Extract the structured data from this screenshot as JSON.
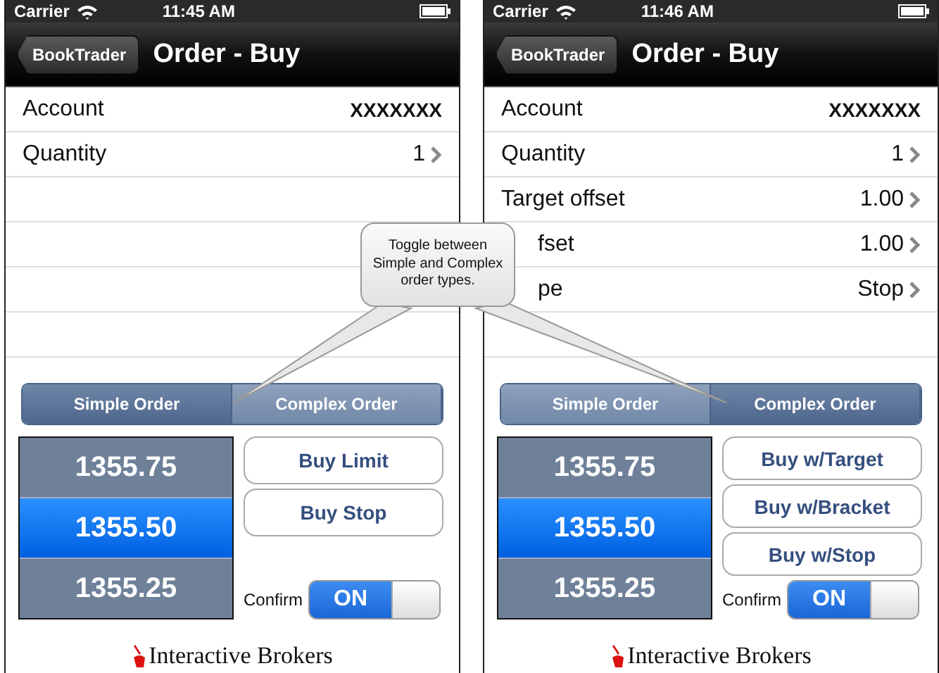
{
  "screens": [
    {
      "status_bar": {
        "carrier": "Carrier",
        "time": "11:45 AM"
      },
      "nav": {
        "back": "BookTrader",
        "title": "Order - Buy"
      },
      "rows": [
        {
          "label": "Account",
          "value": "XXXXXXX",
          "kind": "plain",
          "covered": false
        },
        {
          "label": "Quantity",
          "value": "1",
          "kind": "disclosure",
          "covered": false
        }
      ],
      "segments": [
        {
          "label": "Simple Order",
          "selected": true
        },
        {
          "label": "Complex Order",
          "selected": false
        }
      ],
      "picker": [
        {
          "value": "1355.75",
          "selected": false
        },
        {
          "value": "1355.50",
          "selected": true
        },
        {
          "value": "1355.25",
          "selected": false
        }
      ],
      "buttons": [
        "Buy Limit",
        "Buy Stop"
      ],
      "confirm": {
        "label": "Confirm",
        "on": true,
        "state_text": "ON"
      },
      "logo": "Interactive Brokers"
    },
    {
      "status_bar": {
        "carrier": "Carrier",
        "time": "11:46 AM"
      },
      "nav": {
        "back": "BookTrader",
        "title": "Order - Buy"
      },
      "rows": [
        {
          "label": "Account",
          "value": "XXXXXXX",
          "kind": "plain",
          "covered": false
        },
        {
          "label": "Quantity",
          "value": "1",
          "kind": "disclosure",
          "covered": false
        },
        {
          "label": "Target offset",
          "value": "1.00",
          "kind": "disclosure",
          "covered": false
        },
        {
          "label": "fset",
          "value": "1.00",
          "kind": "disclosure",
          "covered": true
        },
        {
          "label": "pe",
          "value": "Stop",
          "kind": "disclosure",
          "covered": true
        }
      ],
      "segments": [
        {
          "label": "Simple Order",
          "selected": false
        },
        {
          "label": "Complex Order",
          "selected": true
        }
      ],
      "picker": [
        {
          "value": "1355.75",
          "selected": false
        },
        {
          "value": "1355.50",
          "selected": true
        },
        {
          "value": "1355.25",
          "selected": false
        }
      ],
      "buttons": [
        "Buy w/Target",
        "Buy w/Bracket",
        "Buy w/Stop"
      ],
      "confirm": {
        "label": "Confirm",
        "on": true,
        "state_text": "ON"
      },
      "logo": "Interactive Brokers"
    }
  ],
  "callout": {
    "text": "Toggle between Simple and Complex order types."
  }
}
